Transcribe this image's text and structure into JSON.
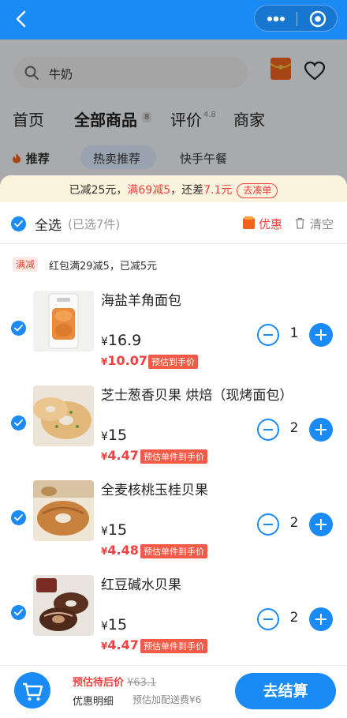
{
  "colors": {
    "accent": "#1a8bf5",
    "price_red": "#f23f3f",
    "banner_bg": "#fcf3dd"
  },
  "topbar": {
    "back_icon": "chevron-left-icon",
    "more_icon": "more-dots-icon",
    "close_icon": "target-icon"
  },
  "store": {
    "search_placeholder": "牛奶",
    "tabs": [
      {
        "label": "首页"
      },
      {
        "label": "全部商品",
        "badge": "8"
      },
      {
        "label": "评价",
        "rating": "4.8"
      },
      {
        "label": "商家"
      }
    ],
    "categories": [
      "推荐",
      "热卖推荐",
      "快手午餐"
    ]
  },
  "cart": {
    "promo": {
      "part1": "已减25元，",
      "part2": "满69减5",
      "part3": "，还差",
      "part4": "7.1元",
      "link": "去凑单"
    },
    "select_all_label": "全选",
    "selected_count": "(已选7件)",
    "discount_label": "优惠",
    "clear_label": "清空",
    "rule_tag": "满减",
    "rule_text": "红包满29减5，已减5元",
    "items": [
      {
        "name": "海盐羊角面包",
        "price": "16.9",
        "final_price": "10.07",
        "final_tag": "预估到手价",
        "qty": "1",
        "thumb": "croissant-bag"
      },
      {
        "name": "芝士葱香贝果 烘焙（现烤面包）",
        "price": "15",
        "final_price": "4.47",
        "final_tag": "预估单件到手价",
        "qty": "2",
        "thumb": "bagel-cheese"
      },
      {
        "name": "全麦核桃玉桂贝果",
        "price": "15",
        "final_price": "4.48",
        "final_tag": "预估单件到手价",
        "qty": "2",
        "thumb": "bagel-walnut"
      },
      {
        "name": "红豆碱水贝果",
        "price": "15",
        "final_price": "4.47",
        "final_tag": "预估单件到手价",
        "qty": "2",
        "thumb": "bagel-redbean"
      }
    ]
  },
  "bottom": {
    "preview_label": "预估待后价",
    "preview_price": "¥63.1",
    "pay_label": "优惠明细",
    "fee_text": "预估加配送费¥6",
    "checkout_label": "去结算"
  }
}
